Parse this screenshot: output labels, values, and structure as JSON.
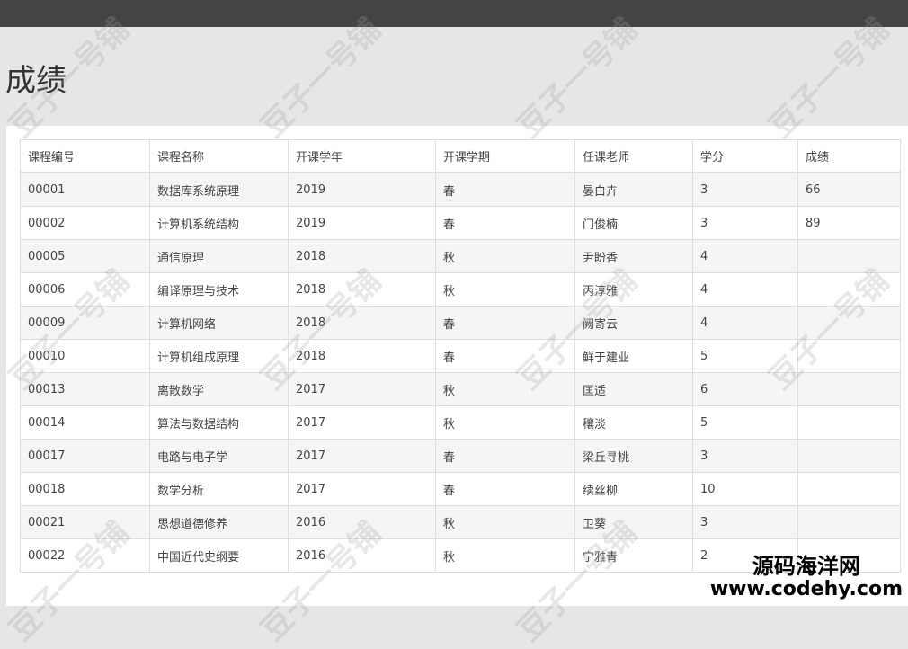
{
  "page": {
    "title": "成绩"
  },
  "table": {
    "headers": [
      "课程编号",
      "课程名称",
      "开课学年",
      "开课学期",
      "任课老师",
      "学分",
      "成绩"
    ],
    "rows": [
      [
        "00001",
        "数据库系统原理",
        "2019",
        "春",
        "晏白卉",
        "3",
        "66"
      ],
      [
        "00002",
        "计算机系统结构",
        "2019",
        "春",
        "门俊楠",
        "3",
        "89"
      ],
      [
        "00005",
        "通信原理",
        "2018",
        "秋",
        "尹盼香",
        "4",
        ""
      ],
      [
        "00006",
        "编译原理与技术",
        "2018",
        "秋",
        "丙淳雅",
        "4",
        ""
      ],
      [
        "00009",
        "计算机网络",
        "2018",
        "春",
        "阙寄云",
        "4",
        ""
      ],
      [
        "00010",
        "计算机组成原理",
        "2018",
        "春",
        "鲜于建业",
        "5",
        ""
      ],
      [
        "00013",
        "离散数学",
        "2017",
        "秋",
        "匡适",
        "6",
        ""
      ],
      [
        "00014",
        "算法与数据结构",
        "2017",
        "秋",
        "穰淡",
        "5",
        ""
      ],
      [
        "00017",
        "电路与电子学",
        "2017",
        "春",
        "梁丘寻桃",
        "3",
        ""
      ],
      [
        "00018",
        "数学分析",
        "2017",
        "春",
        "续丝柳",
        "10",
        ""
      ],
      [
        "00021",
        "思想道德修养",
        "2016",
        "秋",
        "卫葵",
        "3",
        ""
      ],
      [
        "00022",
        "中国近代史纲要",
        "2016",
        "秋",
        "宁雅青",
        "2",
        ""
      ]
    ]
  },
  "watermark": {
    "text": "豆子一号铺"
  },
  "brand": {
    "name": "源码海洋网",
    "url": "www.codehy.com"
  }
}
